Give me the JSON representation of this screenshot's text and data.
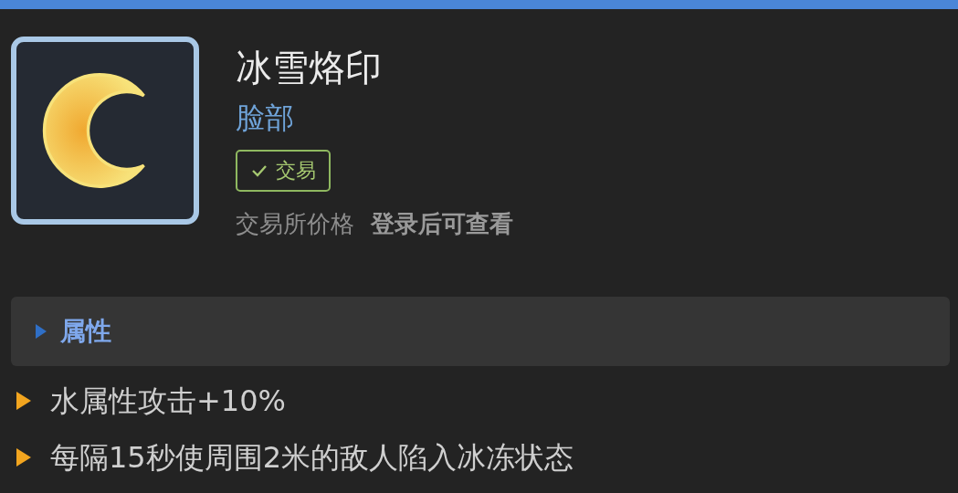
{
  "item": {
    "name": "冰雪烙印",
    "slot": "脸部",
    "tradable": true,
    "trade_label": "交易",
    "price_label": "交易所价格",
    "price_value": "登录后可查看"
  },
  "section": {
    "title": "属性"
  },
  "stats": [
    "水属性攻击+10%",
    "每隔15秒使周围2米的敌人陷入冰冻状态"
  ]
}
